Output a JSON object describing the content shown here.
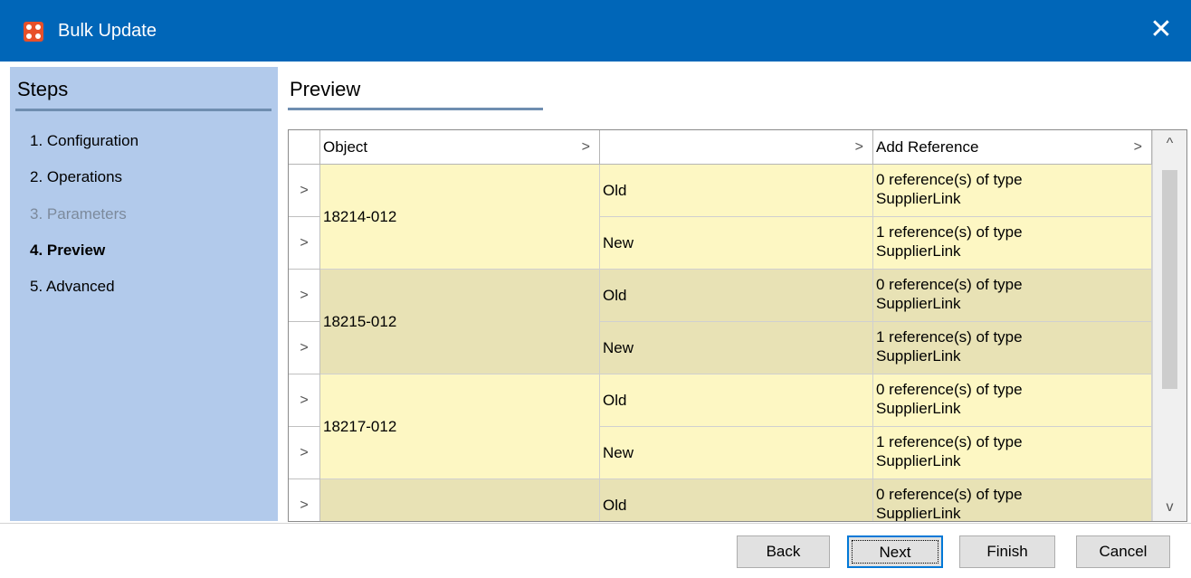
{
  "window": {
    "title": "Bulk Update",
    "close_symbol": "✕"
  },
  "steps": {
    "title": "Steps",
    "items": [
      {
        "label": "1. Configuration",
        "state": "normal"
      },
      {
        "label": "2. Operations",
        "state": "normal"
      },
      {
        "label": "3. Parameters",
        "state": "disabled"
      },
      {
        "label": "4. Preview",
        "state": "active"
      },
      {
        "label": "5. Advanced",
        "state": "normal"
      }
    ]
  },
  "preview": {
    "title": "Preview",
    "columns": [
      "Object",
      "",
      "Add Reference"
    ],
    "groups": [
      {
        "object": "18214-012",
        "rows": [
          {
            "type": "Old",
            "ref_line1": "0 reference(s) of type",
            "ref_line2": "SupplierLink"
          },
          {
            "type": "New",
            "ref_line1": "1 reference(s) of type",
            "ref_line2": "SupplierLink"
          }
        ]
      },
      {
        "object": "18215-012",
        "rows": [
          {
            "type": "Old",
            "ref_line1": "0 reference(s) of type",
            "ref_line2": "SupplierLink"
          },
          {
            "type": "New",
            "ref_line1": "1 reference(s) of type",
            "ref_line2": "SupplierLink"
          }
        ]
      },
      {
        "object": "18217-012",
        "rows": [
          {
            "type": "Old",
            "ref_line1": "0 reference(s) of type",
            "ref_line2": "SupplierLink"
          },
          {
            "type": "New",
            "ref_line1": "1 reference(s) of type",
            "ref_line2": "SupplierLink"
          }
        ]
      },
      {
        "object": "",
        "rows": [
          {
            "type": "Old",
            "ref_line1": "0 reference(s) of type",
            "ref_line2": "SupplierLink"
          }
        ]
      }
    ]
  },
  "buttons": {
    "back": "Back",
    "next": "Next",
    "finish": "Finish",
    "cancel": "Cancel"
  },
  "colors": {
    "title_bar": "#0066b8",
    "steps_panel": "#b2caeb",
    "row_light": "#fdf7c3",
    "row_dark": "#e8e2b5",
    "app_icon": "#e8502a"
  }
}
